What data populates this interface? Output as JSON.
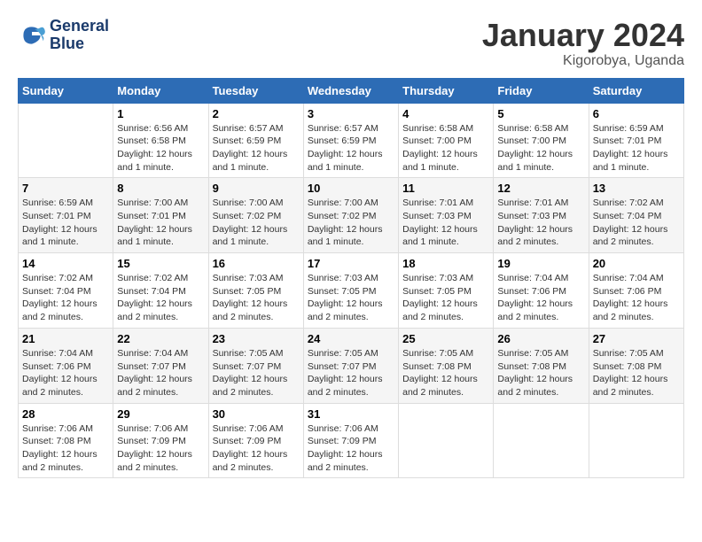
{
  "header": {
    "logo_line1": "General",
    "logo_line2": "Blue",
    "month_year": "January 2024",
    "location": "Kigorobya, Uganda"
  },
  "days_of_week": [
    "Sunday",
    "Monday",
    "Tuesday",
    "Wednesday",
    "Thursday",
    "Friday",
    "Saturday"
  ],
  "weeks": [
    [
      {
        "day": "",
        "info": ""
      },
      {
        "day": "1",
        "info": "Sunrise: 6:56 AM\nSunset: 6:58 PM\nDaylight: 12 hours\nand 1 minute."
      },
      {
        "day": "2",
        "info": "Sunrise: 6:57 AM\nSunset: 6:59 PM\nDaylight: 12 hours\nand 1 minute."
      },
      {
        "day": "3",
        "info": "Sunrise: 6:57 AM\nSunset: 6:59 PM\nDaylight: 12 hours\nand 1 minute."
      },
      {
        "day": "4",
        "info": "Sunrise: 6:58 AM\nSunset: 7:00 PM\nDaylight: 12 hours\nand 1 minute."
      },
      {
        "day": "5",
        "info": "Sunrise: 6:58 AM\nSunset: 7:00 PM\nDaylight: 12 hours\nand 1 minute."
      },
      {
        "day": "6",
        "info": "Sunrise: 6:59 AM\nSunset: 7:01 PM\nDaylight: 12 hours\nand 1 minute."
      }
    ],
    [
      {
        "day": "7",
        "info": "Sunrise: 6:59 AM\nSunset: 7:01 PM\nDaylight: 12 hours\nand 1 minute."
      },
      {
        "day": "8",
        "info": "Sunrise: 7:00 AM\nSunset: 7:01 PM\nDaylight: 12 hours\nand 1 minute."
      },
      {
        "day": "9",
        "info": "Sunrise: 7:00 AM\nSunset: 7:02 PM\nDaylight: 12 hours\nand 1 minute."
      },
      {
        "day": "10",
        "info": "Sunrise: 7:00 AM\nSunset: 7:02 PM\nDaylight: 12 hours\nand 1 minute."
      },
      {
        "day": "11",
        "info": "Sunrise: 7:01 AM\nSunset: 7:03 PM\nDaylight: 12 hours\nand 1 minute."
      },
      {
        "day": "12",
        "info": "Sunrise: 7:01 AM\nSunset: 7:03 PM\nDaylight: 12 hours\nand 2 minutes."
      },
      {
        "day": "13",
        "info": "Sunrise: 7:02 AM\nSunset: 7:04 PM\nDaylight: 12 hours\nand 2 minutes."
      }
    ],
    [
      {
        "day": "14",
        "info": "Sunrise: 7:02 AM\nSunset: 7:04 PM\nDaylight: 12 hours\nand 2 minutes."
      },
      {
        "day": "15",
        "info": "Sunrise: 7:02 AM\nSunset: 7:04 PM\nDaylight: 12 hours\nand 2 minutes."
      },
      {
        "day": "16",
        "info": "Sunrise: 7:03 AM\nSunset: 7:05 PM\nDaylight: 12 hours\nand 2 minutes."
      },
      {
        "day": "17",
        "info": "Sunrise: 7:03 AM\nSunset: 7:05 PM\nDaylight: 12 hours\nand 2 minutes."
      },
      {
        "day": "18",
        "info": "Sunrise: 7:03 AM\nSunset: 7:05 PM\nDaylight: 12 hours\nand 2 minutes."
      },
      {
        "day": "19",
        "info": "Sunrise: 7:04 AM\nSunset: 7:06 PM\nDaylight: 12 hours\nand 2 minutes."
      },
      {
        "day": "20",
        "info": "Sunrise: 7:04 AM\nSunset: 7:06 PM\nDaylight: 12 hours\nand 2 minutes."
      }
    ],
    [
      {
        "day": "21",
        "info": "Sunrise: 7:04 AM\nSunset: 7:06 PM\nDaylight: 12 hours\nand 2 minutes."
      },
      {
        "day": "22",
        "info": "Sunrise: 7:04 AM\nSunset: 7:07 PM\nDaylight: 12 hours\nand 2 minutes."
      },
      {
        "day": "23",
        "info": "Sunrise: 7:05 AM\nSunset: 7:07 PM\nDaylight: 12 hours\nand 2 minutes."
      },
      {
        "day": "24",
        "info": "Sunrise: 7:05 AM\nSunset: 7:07 PM\nDaylight: 12 hours\nand 2 minutes."
      },
      {
        "day": "25",
        "info": "Sunrise: 7:05 AM\nSunset: 7:08 PM\nDaylight: 12 hours\nand 2 minutes."
      },
      {
        "day": "26",
        "info": "Sunrise: 7:05 AM\nSunset: 7:08 PM\nDaylight: 12 hours\nand 2 minutes."
      },
      {
        "day": "27",
        "info": "Sunrise: 7:05 AM\nSunset: 7:08 PM\nDaylight: 12 hours\nand 2 minutes."
      }
    ],
    [
      {
        "day": "28",
        "info": "Sunrise: 7:06 AM\nSunset: 7:08 PM\nDaylight: 12 hours\nand 2 minutes."
      },
      {
        "day": "29",
        "info": "Sunrise: 7:06 AM\nSunset: 7:09 PM\nDaylight: 12 hours\nand 2 minutes."
      },
      {
        "day": "30",
        "info": "Sunrise: 7:06 AM\nSunset: 7:09 PM\nDaylight: 12 hours\nand 2 minutes."
      },
      {
        "day": "31",
        "info": "Sunrise: 7:06 AM\nSunset: 7:09 PM\nDaylight: 12 hours\nand 2 minutes."
      },
      {
        "day": "",
        "info": ""
      },
      {
        "day": "",
        "info": ""
      },
      {
        "day": "",
        "info": ""
      }
    ]
  ]
}
